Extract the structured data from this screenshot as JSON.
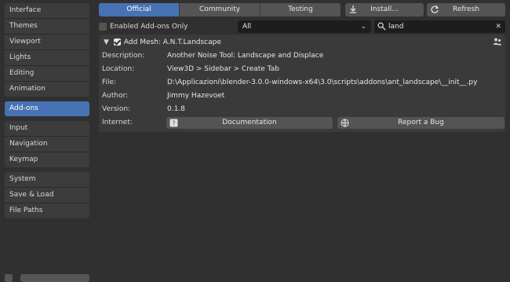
{
  "sidebar": {
    "groups": [
      {
        "items": [
          {
            "label": "Interface"
          },
          {
            "label": "Themes"
          },
          {
            "label": "Viewport"
          },
          {
            "label": "Lights"
          },
          {
            "label": "Editing"
          },
          {
            "label": "Animation"
          }
        ]
      },
      {
        "items": [
          {
            "label": "Add-ons",
            "active": true
          }
        ]
      },
      {
        "items": [
          {
            "label": "Input"
          },
          {
            "label": "Navigation"
          },
          {
            "label": "Keymap"
          }
        ]
      },
      {
        "items": [
          {
            "label": "System"
          },
          {
            "label": "Save & Load"
          },
          {
            "label": "File Paths"
          }
        ]
      }
    ]
  },
  "toolbar": {
    "tabs": [
      "Official",
      "Community",
      "Testing"
    ],
    "active_tab": "Official",
    "install_label": "Install...",
    "refresh_label": "Refresh"
  },
  "filter": {
    "enabled_only_label": "Enabled Add-ons Only",
    "category_value": "All",
    "search_value": "land"
  },
  "addon": {
    "title": "Add Mesh: A.N.T.Landscape",
    "fields": [
      {
        "label": "Description:",
        "value": "Another Noise Tool: Landscape and Displace"
      },
      {
        "label": "Location:",
        "value": "View3D > Sidebar > Create Tab"
      },
      {
        "label": "File:",
        "value": "D:\\Applicazioni\\blender-3.0.0-windows-x64\\3.0\\scripts\\addons\\ant_landscape\\__init__.py"
      },
      {
        "label": "Author:",
        "value": "Jimmy Hazevoet"
      },
      {
        "label": "Version:",
        "value": "0.1.8"
      }
    ],
    "internet_label": "Internet:",
    "documentation_label": "Documentation",
    "report_bug_label": "Report a Bug"
  },
  "colors": {
    "accent": "#4772b3",
    "background": "#303030",
    "panel": "#3a3a3a",
    "button": "#545454",
    "field": "#1d1d1d"
  }
}
